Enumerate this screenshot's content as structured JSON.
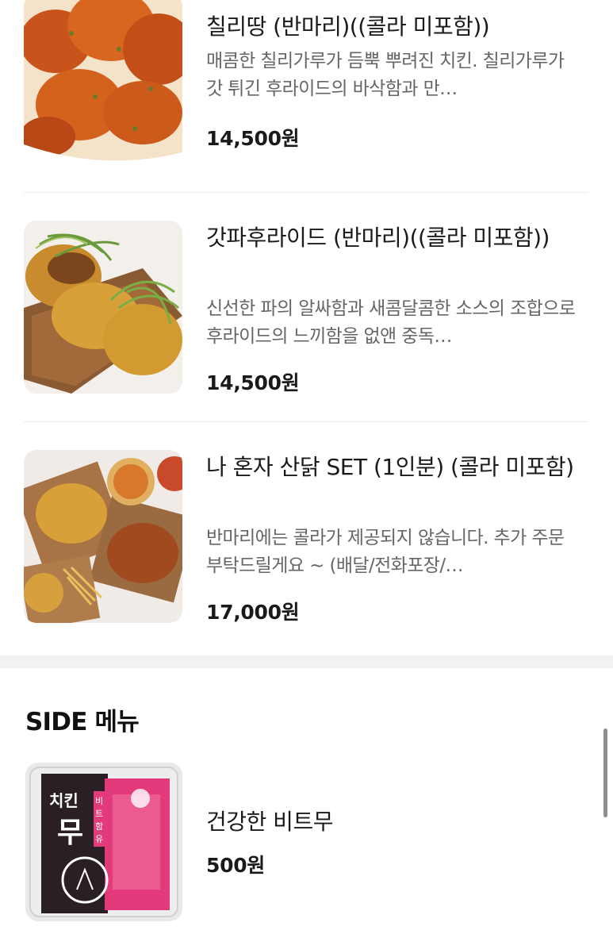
{
  "menu_items": [
    {
      "name": "칠리땅 (반마리)((콜라 미포함))",
      "description": "매콤한 칠리가루가 듬뿍 뿌려진 치킨. 칠리가루가 갓 튀긴 후라이드의 바삭함과 만…",
      "price": "14,500원",
      "image_icon": "chili-fried-chicken-photo"
    },
    {
      "name": "갓파후라이드 (반마리)((콜라 미포함))",
      "description": "신선한 파의 알싸함과 새콤달콤한 소스의 조합으로 후라이드의 느끼함을 없앤 중독…",
      "price": "14,500원",
      "image_icon": "green-onion-chicken-photo"
    },
    {
      "name": "나 혼자 산닭 SET (1인분) (콜라 미포함)",
      "description": "반마리에는 콜라가 제공되지 않습니다. 추가 주문 부탁드릴게요 ~ (배달/전화포장/…",
      "price": "17,000원",
      "image_icon": "chicken-set-photo"
    }
  ],
  "side_section": {
    "title": "SIDE 메뉴",
    "items": [
      {
        "name": "건강한 비트무",
        "price": "500원",
        "image_icon": "pickled-radish-package-photo",
        "package_label_main": "치킨무",
        "package_label_side": "비트함유"
      }
    ]
  },
  "colors": {
    "price": "#1a1a1a",
    "description": "#666666",
    "divider": "#ececec",
    "section_gap": "#f2f2f2"
  }
}
